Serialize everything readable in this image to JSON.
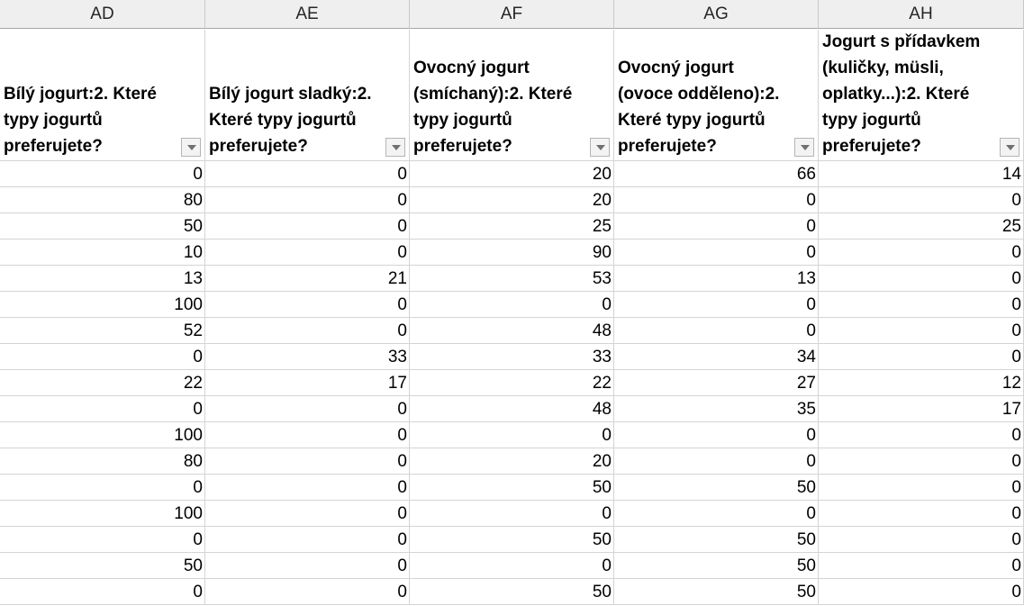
{
  "column_letters": [
    "AD",
    "AE",
    "AF",
    "AG",
    "AH"
  ],
  "headers": [
    "Bílý jogurt:2. Které typy jogurtů preferujete?",
    "Bílý jogurt sladký:2. Které typy jogurtů preferujete?",
    "Ovocný jogurt (smíchaný):2. Které typy jogurtů preferujete?",
    "Ovocný jogurt (ovoce odděleno):2. Které typy jogurtů preferujete?",
    "Jogurt s přídavkem (kuličky, müsli, oplatky...):2. Které typy jogurtů preferujete?"
  ],
  "rows": [
    [
      "0",
      "0",
      "20",
      "66",
      "14"
    ],
    [
      "80",
      "0",
      "20",
      "0",
      "0"
    ],
    [
      "50",
      "0",
      "25",
      "0",
      "25"
    ],
    [
      "10",
      "0",
      "90",
      "0",
      "0"
    ],
    [
      "13",
      "21",
      "53",
      "13",
      "0"
    ],
    [
      "100",
      "0",
      "0",
      "0",
      "0"
    ],
    [
      "52",
      "0",
      "48",
      "0",
      "0"
    ],
    [
      "0",
      "33",
      "33",
      "34",
      "0"
    ],
    [
      "22",
      "17",
      "22",
      "27",
      "12"
    ],
    [
      "0",
      "0",
      "48",
      "35",
      "17"
    ],
    [
      "100",
      "0",
      "0",
      "0",
      "0"
    ],
    [
      "80",
      "0",
      "20",
      "0",
      "0"
    ],
    [
      "0",
      "0",
      "50",
      "50",
      "0"
    ],
    [
      "100",
      "0",
      "0",
      "0",
      "0"
    ],
    [
      "0",
      "0",
      "50",
      "50",
      "0"
    ],
    [
      "50",
      "0",
      "0",
      "50",
      "0"
    ],
    [
      "0",
      "0",
      "50",
      "50",
      "0"
    ]
  ]
}
